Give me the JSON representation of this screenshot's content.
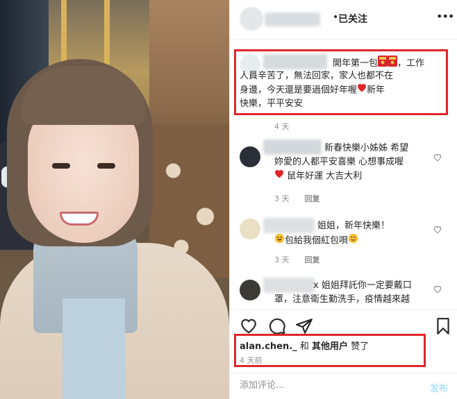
{
  "header": {
    "separator": "•",
    "follow_label": "已关注",
    "more_icon": "more-horizontal-icon"
  },
  "comments": [
    {
      "text": "開年第一包🧧🧧，工作人員辛苦了，無法回家，家人也都不在身邊，今天還是要過個好年喔❤️新年快樂，平平安安",
      "line1": "開年第一包",
      "line1_end": "，工作",
      "line2": "人員辛苦了，無法回家，家人也都不在",
      "line3": "身邊，今天還是要過個好年喔",
      "line3_end": "新年",
      "line4": "快樂，平平安安",
      "time": "4 天"
    },
    {
      "line1": "新春快樂小姊姊 希望",
      "line2": "妳愛的人都平安喜樂 心想事成喔",
      "line3": "鼠年好運 大吉大利",
      "time": "3 天",
      "reply": "回复"
    },
    {
      "line1": "姐姐，新年快樂！",
      "line2": "包給我個紅包唄",
      "time": "3 天",
      "reply": "回复"
    },
    {
      "line1": "x 姐姐拜託你一定要戴口",
      "line2": "罩，注意衛生勤洗手，疫情越來越"
    }
  ],
  "likes": {
    "user": "alan.chen._",
    "and": "和",
    "others": "其他用户",
    "suffix": "赞了"
  },
  "timestamp": "4 天前",
  "add_comment": {
    "placeholder": "添加评论...",
    "post_label": "发布"
  },
  "colors": {
    "highlight_box": "#e0262a",
    "post_button_disabled": "#b2dffc",
    "meta_gray": "#8e8e8e"
  }
}
